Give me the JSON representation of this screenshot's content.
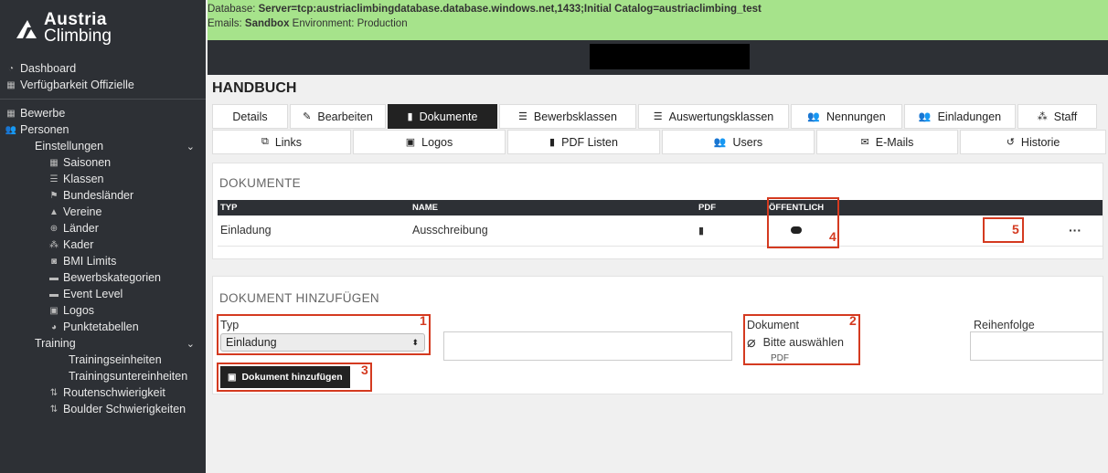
{
  "logo": {
    "line1": "Austria",
    "line2": "Climbing"
  },
  "sidebar": {
    "dashboard": "Dashboard",
    "verfuegbarkeit": "Verfügbarkeit Offizielle",
    "bewerbe": "Bewerbe",
    "personen": "Personen",
    "einstellungen": "Einstellungen",
    "settings_items": [
      "Saisonen",
      "Klassen",
      "Bundesländer",
      "Vereine",
      "Länder",
      "Kader",
      "BMI Limits",
      "Bewerbskategorien",
      "Event Level",
      "Logos",
      "Punktetabellen"
    ],
    "training": "Training",
    "training_items": [
      "Trainingseinheiten",
      "Trainingsuntereinheiten"
    ],
    "routen": "Routenschwierigkeit",
    "boulder": "Boulder Schwierigkeiten"
  },
  "banner": {
    "db_prefix": "Database: ",
    "db_value": "Server=tcp:austriaclimbingdatabase.database.windows.net,1433;Initial Catalog=austriaclimbing_test",
    "emails_prefix": "Emails: ",
    "emails_value": "Sandbox",
    "env": " Environment: Production"
  },
  "page_title": "HANDBUCH",
  "tabs_row1": [
    "Details",
    "Bearbeiten",
    "Dokumente",
    "Bewerbsklassen",
    "Auswertungsklassen",
    "Nennungen",
    "Einladungen",
    "Staff"
  ],
  "tabs_row2": [
    "Links",
    "Logos",
    "PDF Listen",
    "Users",
    "E-Mails",
    "Historie"
  ],
  "dokumente": {
    "title": "DOKUMENTE",
    "headers": [
      "TYP",
      "NAME",
      "PDF",
      "ÖFFENTLICH",
      ""
    ],
    "rows": [
      {
        "typ": "Einladung",
        "name": "Ausschreibung",
        "actions": "···"
      }
    ]
  },
  "add": {
    "title": "DOKUMENT HINZUFÜGEN",
    "typ_label": "Typ",
    "typ_value": "Einladung",
    "dokument_label": "Dokument",
    "dokument_select": "Bitte auswählen",
    "dokument_hint": "PDF",
    "reihenfolge_label": "Reihenfolge",
    "button": "Dokument hinzufügen"
  },
  "annotations": [
    "1",
    "2",
    "3",
    "4",
    "5"
  ],
  "colors": {
    "accent_red": "#d43a20",
    "banner_green": "#a6e38b",
    "dark": "#2d3035"
  }
}
